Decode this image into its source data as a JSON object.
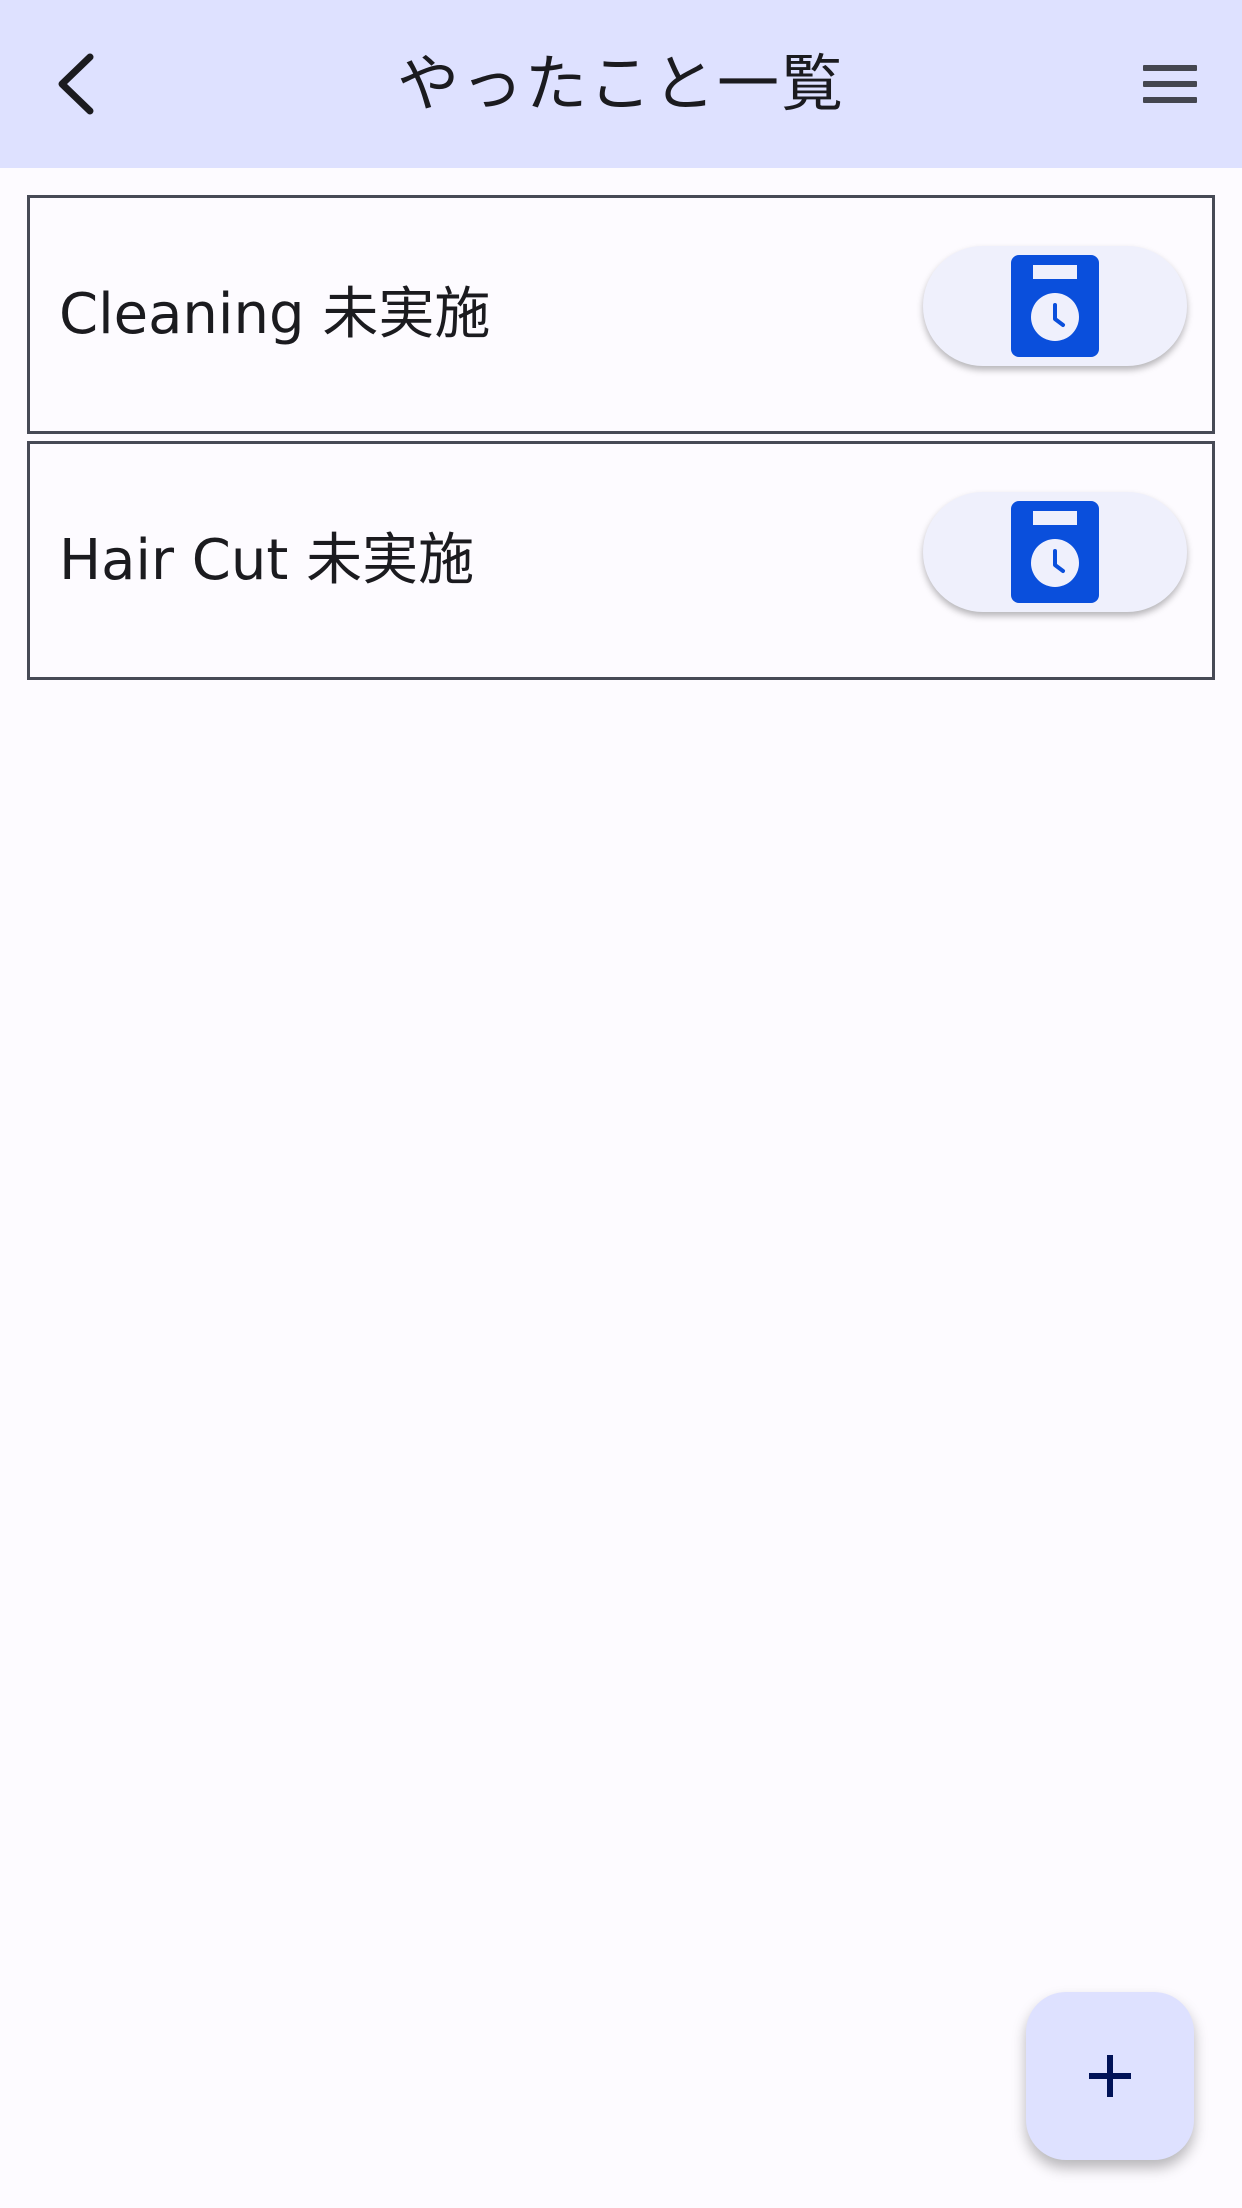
{
  "app_bar": {
    "title": "やったこと一覧",
    "back_icon": "chevron-left-icon",
    "menu_icon": "hamburger-menu-icon",
    "background": "#dee1ff"
  },
  "items": [
    {
      "label": "Cleaning 未実施",
      "action_icon": "timer-bag-icon"
    },
    {
      "label": "Hair Cut 未実施",
      "action_icon": "timer-bag-icon"
    }
  ],
  "fab": {
    "icon": "plus-icon",
    "background": "#dee1ff"
  },
  "colors": {
    "accent": "#0a4fdc",
    "background": "#fdfbff",
    "border": "#474a56"
  }
}
